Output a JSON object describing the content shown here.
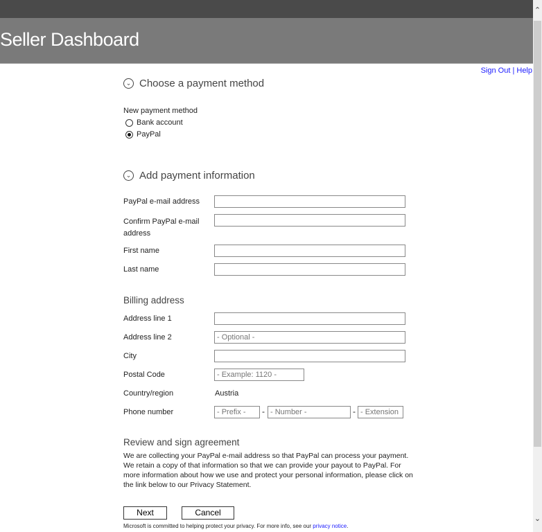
{
  "header": {
    "title": "Seller Dashboard"
  },
  "links": {
    "sign_out": "Sign Out",
    "separator": "|",
    "help": "Help"
  },
  "section1": {
    "title": "Choose a payment method",
    "label": "New payment method",
    "options": [
      {
        "label": "Bank account",
        "selected": false
      },
      {
        "label": "PayPal",
        "selected": true
      }
    ]
  },
  "section2": {
    "title": "Add payment information"
  },
  "fields": {
    "email": "PayPal e-mail address",
    "confirm": "Confirm PayPal e-mail address",
    "first": "First name",
    "last": "Last name"
  },
  "billing": {
    "title": "Billing address",
    "address1": "Address line 1",
    "address2": "Address line 2",
    "address2_placeholder": "- Optional -",
    "city": "City",
    "postal": "Postal Code",
    "postal_placeholder": "- Example: 1120 -",
    "country_label": "Country/region",
    "country_value": "Austria",
    "phone": "Phone number",
    "prefix": "- Prefix -",
    "number": "- Number -",
    "extension": "- Extension -",
    "dash": "-"
  },
  "agreement": {
    "title": "Review and sign agreement",
    "text": "We are collecting your PayPal e-mail address so that PayPal can process your payment. We retain a copy of that information so that we can provide your payout to PayPal. For more information about how we use and protect your personal information, please click on the link below to our Privacy Statement."
  },
  "buttons": {
    "next": "Next",
    "cancel": "Cancel"
  },
  "footer": {
    "text": "Microsoft is committed to helping protect your privacy. For more info, see our ",
    "link": "privacy notice",
    "end": "."
  }
}
